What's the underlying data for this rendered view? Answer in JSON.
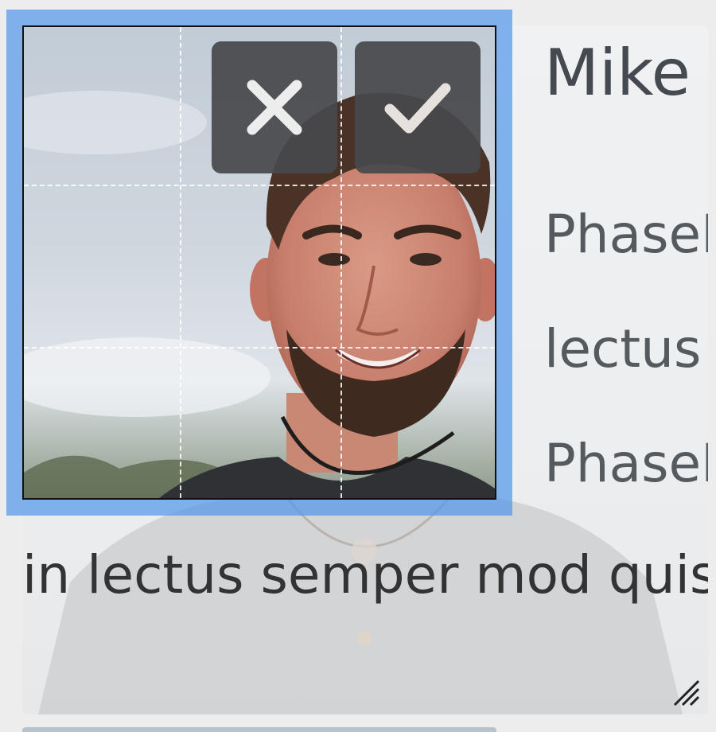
{
  "card": {
    "title": "Mike",
    "lines": [
      "PhaseL",
      "lectus",
      "PhaseL",
      "in lectus semper mod quis"
    ]
  },
  "crop": {
    "cancel_icon": "close-icon",
    "confirm_icon": "check-icon",
    "photo": "portrait-photo"
  },
  "colors": {
    "accent": "#5096eb",
    "button_bg": "#46484b",
    "card_bg": "#eeeff1",
    "text": "#555a5f"
  }
}
